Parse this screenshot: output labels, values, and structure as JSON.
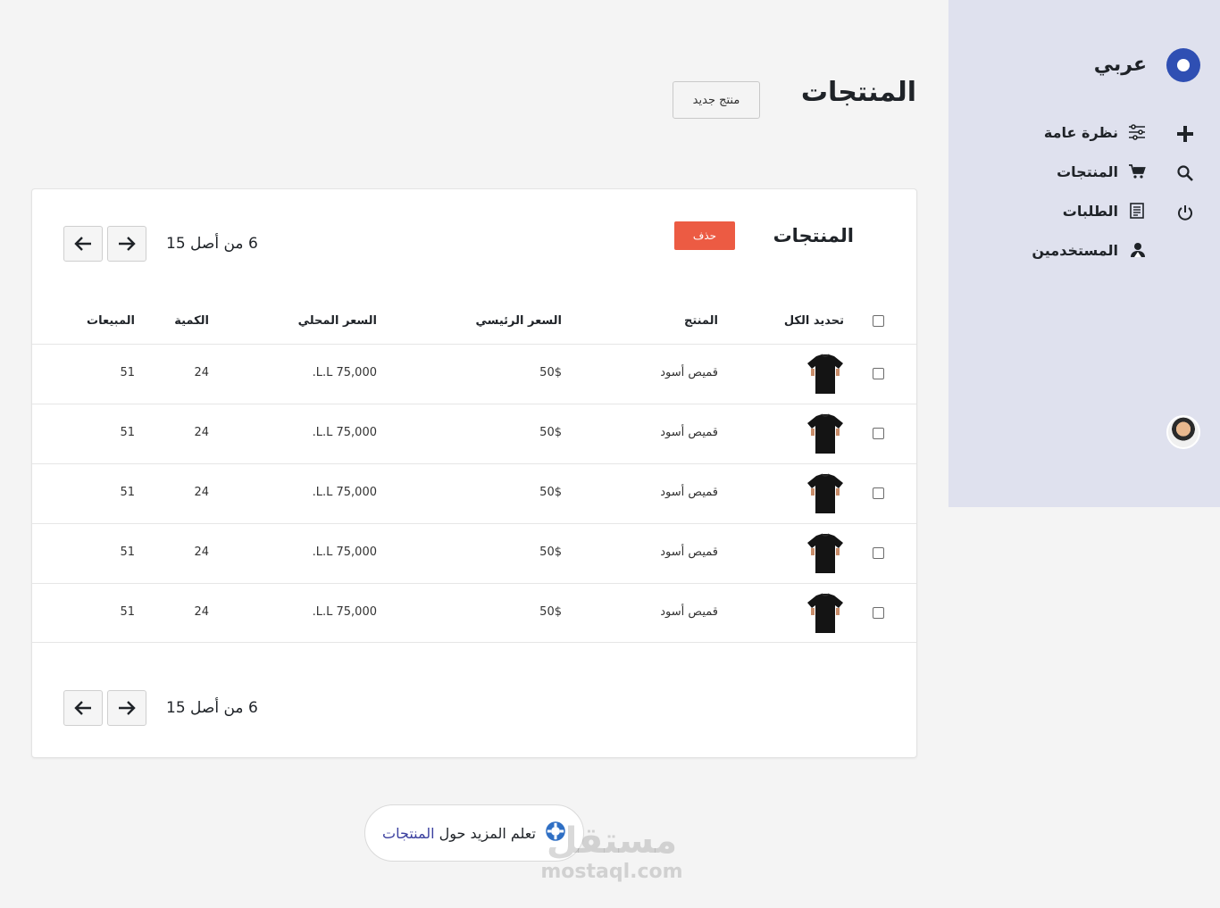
{
  "sidebar": {
    "brand": "عربي",
    "nav": [
      {
        "label": "نظرة عامة",
        "icon": "sliders-icon"
      },
      {
        "label": "المنتجات",
        "icon": "cart-icon"
      },
      {
        "label": "الطلبات",
        "icon": "document-icon"
      },
      {
        "label": "المستخدمين",
        "icon": "users-icon"
      }
    ],
    "actions": [
      "plus-icon",
      "search-icon",
      "power-icon"
    ]
  },
  "header": {
    "title": "المنتجات",
    "new_button": "منتج جديد"
  },
  "card": {
    "title": "المنتجات",
    "delete_button": "حذف",
    "pagination": "6 من أصل 15",
    "columns": {
      "select_all": "تحديد الكل",
      "product": "المنتج",
      "main_price": "السعر الرئيسي",
      "local_price": "السعر المحلي",
      "quantity": "الكمية",
      "sales": "المبيعات"
    },
    "rows": [
      {
        "product": "قميص أسود",
        "main_price": "50$",
        "local_price": "75,000 L.L.",
        "quantity": "24",
        "sales": "51"
      },
      {
        "product": "قميص أسود",
        "main_price": "50$",
        "local_price": "75,000 L.L.",
        "quantity": "24",
        "sales": "51"
      },
      {
        "product": "قميص أسود",
        "main_price": "50$",
        "local_price": "75,000 L.L.",
        "quantity": "24",
        "sales": "51"
      },
      {
        "product": "قميص أسود",
        "main_price": "50$",
        "local_price": "75,000 L.L.",
        "quantity": "24",
        "sales": "51"
      },
      {
        "product": "قميص أسود",
        "main_price": "50$",
        "local_price": "75,000 L.L.",
        "quantity": "24",
        "sales": "51"
      }
    ]
  },
  "learn_more": {
    "prefix": "تعلم المزيد حول",
    "link": "المنتجات"
  },
  "watermark": {
    "arabic": "مستقل",
    "latin": "mostaql.com"
  },
  "colors": {
    "accent": "#2f4fb3",
    "danger": "#ec5b43",
    "sidebar_bg": "#dfe1ee"
  }
}
